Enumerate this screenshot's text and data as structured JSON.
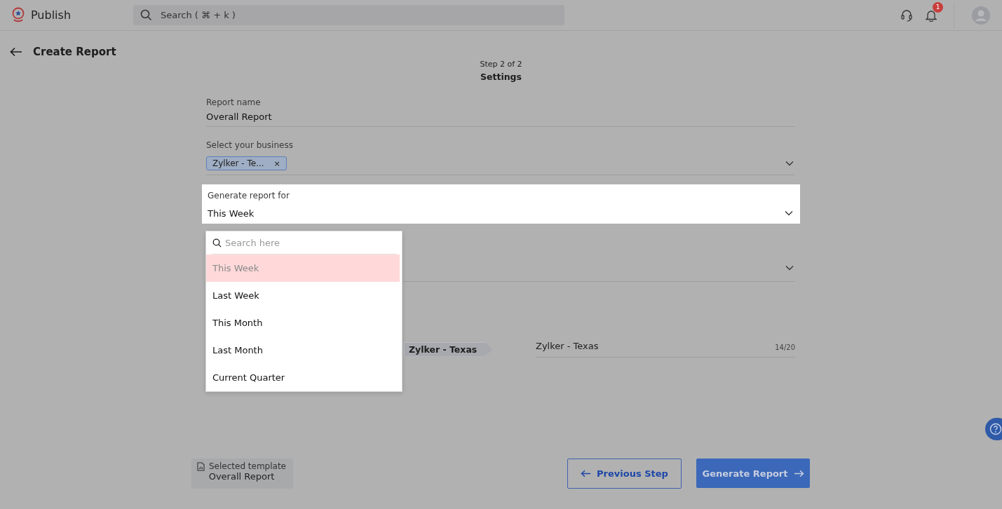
{
  "app": {
    "name": "Publish"
  },
  "search": {
    "placeholder": "Search ( ⌘ + k )"
  },
  "notifications": {
    "count": "1"
  },
  "page": {
    "title": "Create Report",
    "step": "Step 2 of 2",
    "step_title": "Settings"
  },
  "report_name": {
    "label": "Report name",
    "value": "Overall Report"
  },
  "business": {
    "label": "Select your business",
    "chips": [
      {
        "label": "Zylker - Te...",
        "remove": "×"
      }
    ]
  },
  "period": {
    "label": "Generate report for",
    "value": "This Week",
    "expanded": true,
    "search_placeholder": "Search here",
    "options": [
      {
        "label": "This Week",
        "selected": true
      },
      {
        "label": "Last Week",
        "selected": false
      },
      {
        "label": "This Month",
        "selected": false
      },
      {
        "label": "Last Month",
        "selected": false
      },
      {
        "label": "Current Quarter",
        "selected": false
      }
    ]
  },
  "branding": {
    "tag": "Zylker - Texas",
    "input_value": "Zylker - Texas",
    "counter": "14/20"
  },
  "template": {
    "label": "Selected template",
    "name": "Overall Report"
  },
  "buttons": {
    "previous": "Previous Step",
    "generate": "Generate Report"
  }
}
